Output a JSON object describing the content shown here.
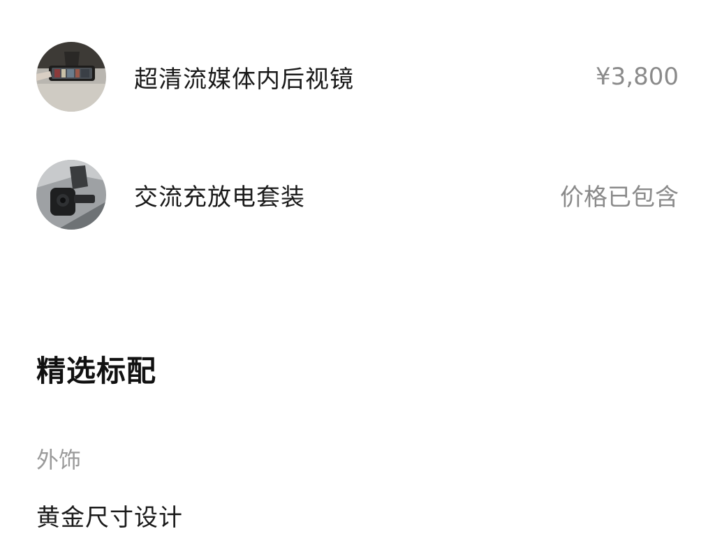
{
  "options": [
    {
      "icon": "rearview-mirror-photo",
      "label": "超清流媒体内后视镜",
      "value": "¥3,800"
    },
    {
      "icon": "charging-adapter-photo",
      "label": "交流充放电套装",
      "value": "价格已包含"
    }
  ],
  "section": {
    "title": "精选标配",
    "category": "外饰",
    "item": "黄金尺寸设计"
  },
  "colors": {
    "text_primary": "#1a1a1a",
    "text_secondary": "#8a8a8a",
    "background": "#ffffff"
  }
}
